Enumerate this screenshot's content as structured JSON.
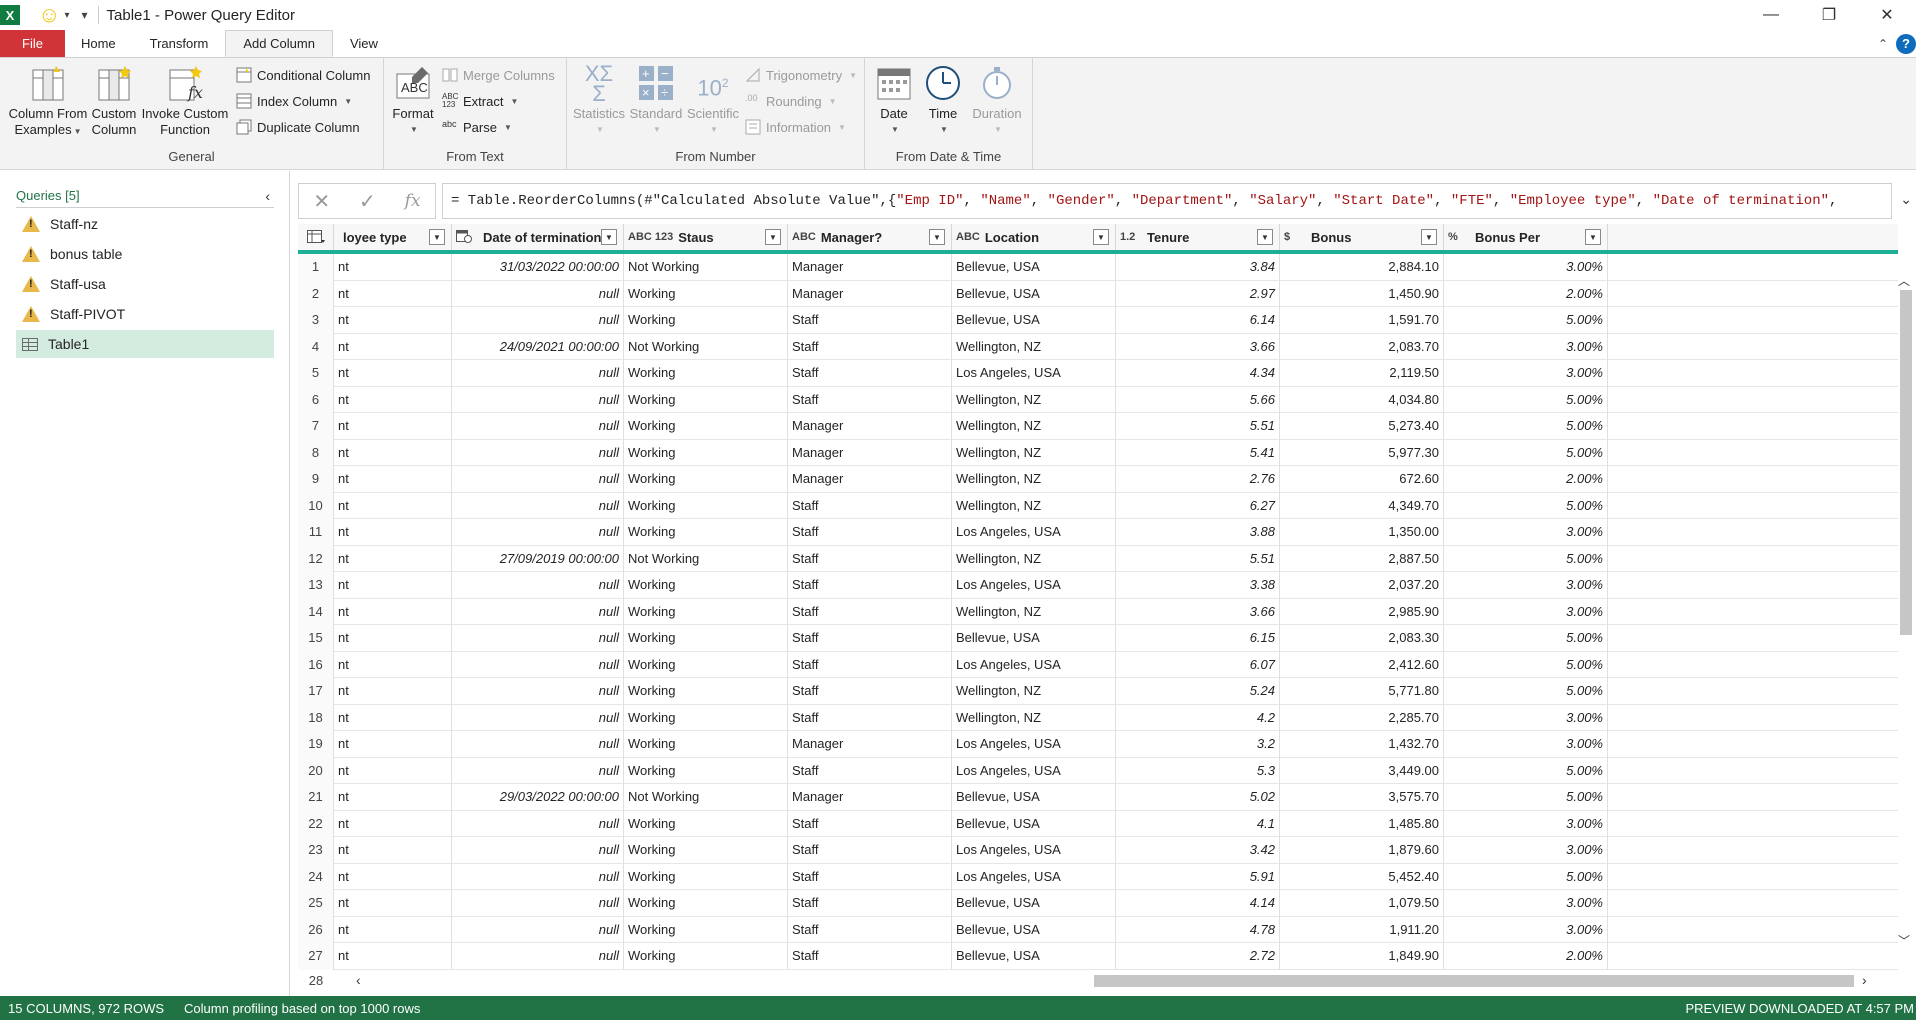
{
  "window": {
    "title": "Table1 - Power Query Editor",
    "app_icon": "X"
  },
  "tabs": [
    {
      "label": "File"
    },
    {
      "label": "Home"
    },
    {
      "label": "Transform"
    },
    {
      "label": "Add Column"
    },
    {
      "label": "View"
    }
  ],
  "active_tab": "Add Column",
  "ribbon": {
    "general": {
      "label": "General",
      "column_from_examples": "Column From Examples",
      "column_from_examples_l1": "Column From",
      "column_from_examples_l2": "Examples",
      "custom_column_l1": "Custom",
      "custom_column_l2": "Column",
      "invoke_custom_function_l1": "Invoke Custom",
      "invoke_custom_function_l2": "Function",
      "conditional_column": "Conditional Column",
      "index_column": "Index Column",
      "duplicate_column": "Duplicate Column"
    },
    "from_text": {
      "label": "From Text",
      "format": "Format",
      "merge_columns": "Merge Columns",
      "extract": "Extract",
      "parse": "Parse"
    },
    "from_number": {
      "label": "From Number",
      "statistics": "Statistics",
      "standard": "Standard",
      "scientific": "Scientific",
      "trigonometry": "Trigonometry",
      "rounding": "Rounding",
      "information": "Information"
    },
    "from_date_time": {
      "label": "From Date & Time",
      "date": "Date",
      "time": "Time",
      "duration": "Duration"
    }
  },
  "queries": {
    "header": "Queries [5]",
    "items": [
      {
        "label": "Staff-nz",
        "icon": "warning-icon"
      },
      {
        "label": "bonus table",
        "icon": "warning-icon"
      },
      {
        "label": "Staff-usa",
        "icon": "warning-icon"
      },
      {
        "label": "Staff-PIVOT",
        "icon": "warning-icon"
      },
      {
        "label": "Table1",
        "icon": "table-icon",
        "selected": true
      }
    ]
  },
  "formula": {
    "prefix": "= Table.ReorderColumns(#\"Calculated Absolute Value\",{",
    "strings": [
      "\"Emp ID\"",
      "\"Name\"",
      "\"Gender\"",
      "\"Department\"",
      "\"Salary\"",
      "\"Start Date\"",
      "\"FTE\"",
      "\"Employee type\"",
      "\"Date of termination\""
    ],
    "separator": ", ",
    "suffix": ","
  },
  "columns": [
    {
      "label": "loyee type",
      "type": ""
    },
    {
      "label": "Date of termination",
      "type": "date-time-icon"
    },
    {
      "label": "Staus",
      "type": "ABC 123"
    },
    {
      "label": "Manager?",
      "type": "ABC"
    },
    {
      "label": "Location",
      "type": "ABC"
    },
    {
      "label": "Tenure",
      "type": "1.2"
    },
    {
      "label": "Bonus",
      "type": "$"
    },
    {
      "label": "Bonus Per",
      "type": "%"
    }
  ],
  "rows": [
    [
      "nt",
      "31/03/2022 00:00:00",
      "Not Working",
      "Manager",
      "Bellevue, USA",
      "3.84",
      "2,884.10",
      "3.00%"
    ],
    [
      "nt",
      "null",
      "Working",
      "Manager",
      "Bellevue, USA",
      "2.97",
      "1,450.90",
      "2.00%"
    ],
    [
      "nt",
      "null",
      "Working",
      "Staff",
      "Bellevue, USA",
      "6.14",
      "1,591.70",
      "5.00%"
    ],
    [
      "nt",
      "24/09/2021 00:00:00",
      "Not Working",
      "Staff",
      "Wellington, NZ",
      "3.66",
      "2,083.70",
      "3.00%"
    ],
    [
      "nt",
      "null",
      "Working",
      "Staff",
      "Los Angeles, USA",
      "4.34",
      "2,119.50",
      "3.00%"
    ],
    [
      "nt",
      "null",
      "Working",
      "Staff",
      "Wellington, NZ",
      "5.66",
      "4,034.80",
      "5.00%"
    ],
    [
      "nt",
      "null",
      "Working",
      "Manager",
      "Wellington, NZ",
      "5.51",
      "5,273.40",
      "5.00%"
    ],
    [
      "nt",
      "null",
      "Working",
      "Manager",
      "Wellington, NZ",
      "5.41",
      "5,977.30",
      "5.00%"
    ],
    [
      "nt",
      "null",
      "Working",
      "Manager",
      "Wellington, NZ",
      "2.76",
      "672.60",
      "2.00%"
    ],
    [
      "nt",
      "null",
      "Working",
      "Staff",
      "Wellington, NZ",
      "6.27",
      "4,349.70",
      "5.00%"
    ],
    [
      "nt",
      "null",
      "Working",
      "Staff",
      "Los Angeles, USA",
      "3.88",
      "1,350.00",
      "3.00%"
    ],
    [
      "nt",
      "27/09/2019 00:00:00",
      "Not Working",
      "Staff",
      "Wellington, NZ",
      "5.51",
      "2,887.50",
      "5.00%"
    ],
    [
      "nt",
      "null",
      "Working",
      "Staff",
      "Los Angeles, USA",
      "3.38",
      "2,037.20",
      "3.00%"
    ],
    [
      "nt",
      "null",
      "Working",
      "Staff",
      "Wellington, NZ",
      "3.66",
      "2,985.90",
      "3.00%"
    ],
    [
      "nt",
      "null",
      "Working",
      "Staff",
      "Bellevue, USA",
      "6.15",
      "2,083.30",
      "5.00%"
    ],
    [
      "nt",
      "null",
      "Working",
      "Staff",
      "Los Angeles, USA",
      "6.07",
      "2,412.60",
      "5.00%"
    ],
    [
      "nt",
      "null",
      "Working",
      "Staff",
      "Wellington, NZ",
      "5.24",
      "5,771.80",
      "5.00%"
    ],
    [
      "nt",
      "null",
      "Working",
      "Staff",
      "Wellington, NZ",
      "4.2",
      "2,285.70",
      "3.00%"
    ],
    [
      "nt",
      "null",
      "Working",
      "Manager",
      "Los Angeles, USA",
      "3.2",
      "1,432.70",
      "3.00%"
    ],
    [
      "nt",
      "null",
      "Working",
      "Staff",
      "Los Angeles, USA",
      "5.3",
      "3,449.00",
      "5.00%"
    ],
    [
      "nt",
      "29/03/2022 00:00:00",
      "Not Working",
      "Manager",
      "Bellevue, USA",
      "5.02",
      "3,575.70",
      "5.00%"
    ],
    [
      "nt",
      "null",
      "Working",
      "Staff",
      "Bellevue, USA",
      "4.1",
      "1,485.80",
      "3.00%"
    ],
    [
      "nt",
      "null",
      "Working",
      "Staff",
      "Los Angeles, USA",
      "3.42",
      "1,879.60",
      "3.00%"
    ],
    [
      "nt",
      "null",
      "Working",
      "Staff",
      "Los Angeles, USA",
      "5.91",
      "5,452.40",
      "5.00%"
    ],
    [
      "nt",
      "null",
      "Working",
      "Staff",
      "Bellevue, USA",
      "4.14",
      "1,079.50",
      "3.00%"
    ],
    [
      "nt",
      "null",
      "Working",
      "Staff",
      "Bellevue, USA",
      "4.78",
      "1,911.20",
      "3.00%"
    ],
    [
      "nt",
      "null",
      "Working",
      "Staff",
      "Bellevue, USA",
      "2.72",
      "1,849.90",
      "2.00%"
    ]
  ],
  "partial_row_number": "28",
  "status": {
    "columns_rows": "15 COLUMNS, 972 ROWS",
    "profiling": "Column profiling based on top 1000 rows",
    "preview": "PREVIEW DOWNLOADED AT 4:57 PM"
  },
  "colors": {
    "accent_green": "#217346",
    "file_tab": "#d13438",
    "header_underline": "#1fae98",
    "selected_query": "#d4ece0"
  }
}
